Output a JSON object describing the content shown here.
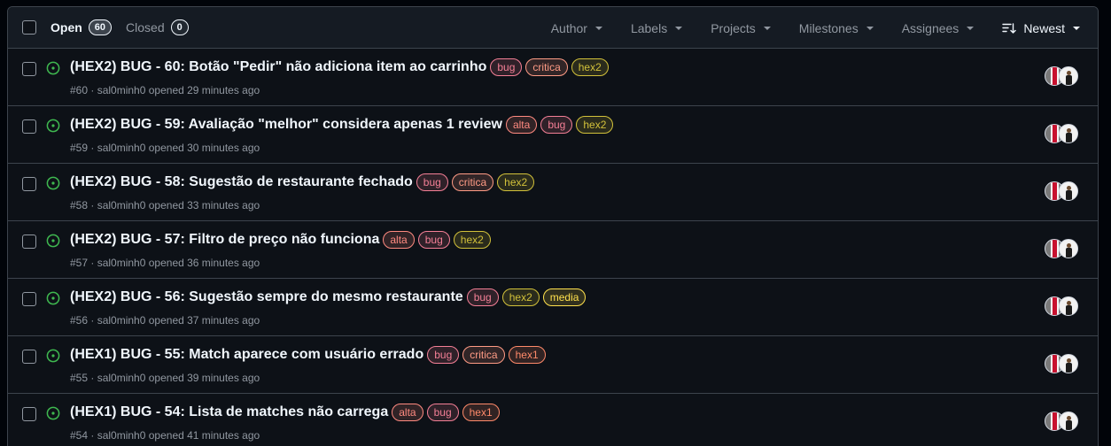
{
  "header": {
    "open_label": "Open",
    "open_count": "60",
    "closed_label": "Closed",
    "closed_count": "0",
    "filters": {
      "author": "Author",
      "labels": "Labels",
      "projects": "Projects",
      "milestones": "Milestones",
      "assignees": "Assignees",
      "sort": "Newest"
    }
  },
  "colors": {
    "open_state": "#3fb950",
    "bug": "#f47f96",
    "critica": "#ff9b85",
    "hex2": "#d2c13a",
    "alta": "#ff8a80",
    "media": "#ffe14d",
    "hex1": "#ff8a6a"
  },
  "issues": [
    {
      "title": "(HEX2) BUG - 60: Botão \"Pedir\" não adiciona item ao carrinho",
      "labels": [
        "bug",
        "critica",
        "hex2"
      ],
      "number": "#60",
      "author": "sal0minh0",
      "opened": "opened 29 minutes ago"
    },
    {
      "title": "(HEX2) BUG - 59: Avaliação \"melhor\" considera apenas 1 review",
      "labels": [
        "alta",
        "bug",
        "hex2"
      ],
      "number": "#59",
      "author": "sal0minh0",
      "opened": "opened 30 minutes ago"
    },
    {
      "title": "(HEX2) BUG - 58: Sugestão de restaurante fechado",
      "labels": [
        "bug",
        "critica",
        "hex2"
      ],
      "number": "#58",
      "author": "sal0minh0",
      "opened": "opened 33 minutes ago"
    },
    {
      "title": "(HEX2) BUG - 57: Filtro de preço não funciona",
      "labels": [
        "alta",
        "bug",
        "hex2"
      ],
      "number": "#57",
      "author": "sal0minh0",
      "opened": "opened 36 minutes ago"
    },
    {
      "title": "(HEX2) BUG - 56: Sugestão sempre do mesmo restaurante",
      "labels": [
        "bug",
        "hex2",
        "media"
      ],
      "number": "#56",
      "author": "sal0minh0",
      "opened": "opened 37 minutes ago"
    },
    {
      "title": "(HEX1) BUG - 55: Match aparece com usuário errado",
      "labels": [
        "bug",
        "critica",
        "hex1"
      ],
      "number": "#55",
      "author": "sal0minh0",
      "opened": "opened 39 minutes ago"
    },
    {
      "title": "(HEX1) BUG - 54: Lista de matches não carrega",
      "labels": [
        "alta",
        "bug",
        "hex1"
      ],
      "number": "#54",
      "author": "sal0minh0",
      "opened": "opened 41 minutes ago"
    }
  ]
}
